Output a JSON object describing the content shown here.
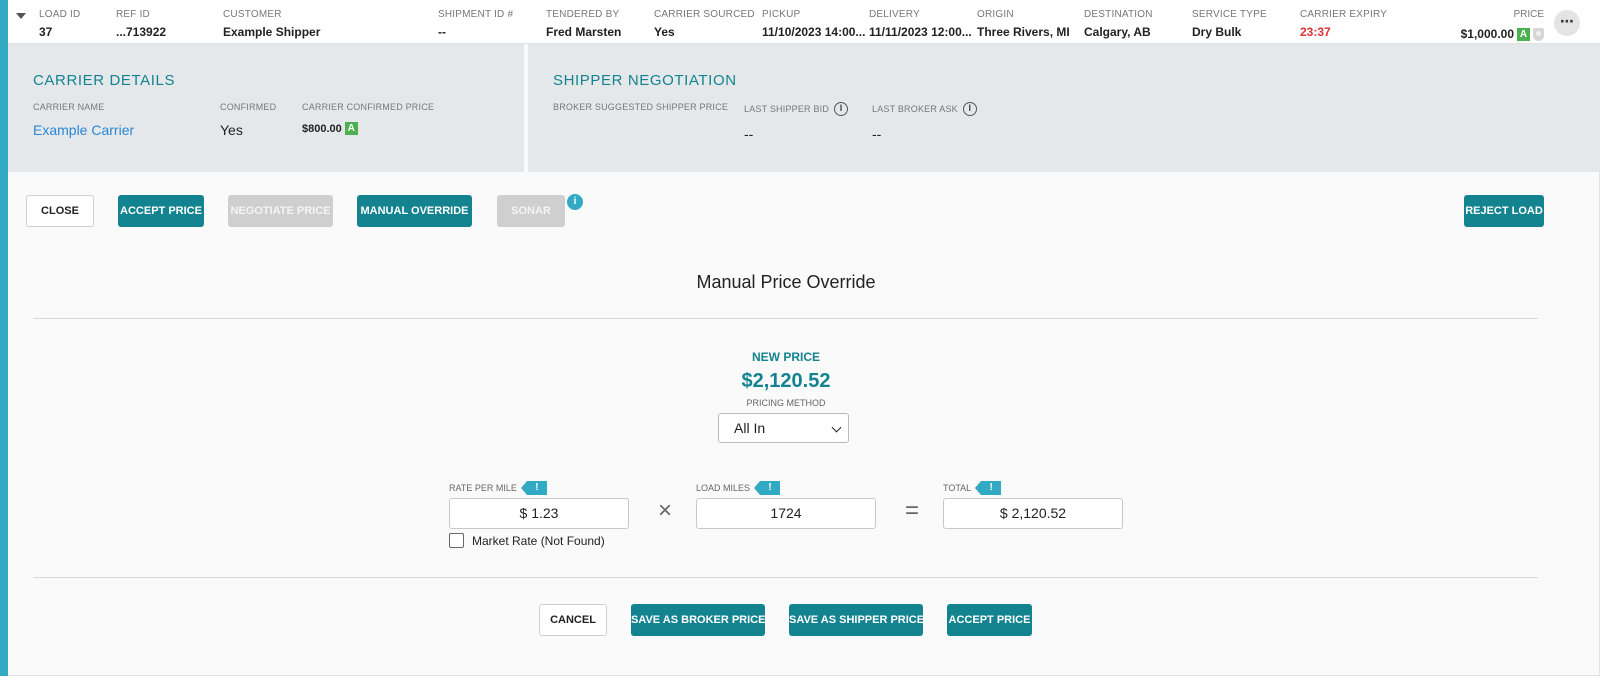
{
  "summary": {
    "columns": [
      {
        "label": "LOAD ID",
        "value": "37"
      },
      {
        "label": "REF ID",
        "value": "...713922"
      },
      {
        "label": "CUSTOMER",
        "value": "Example Shipper"
      },
      {
        "label": "SHIPMENT ID #",
        "value": "--"
      },
      {
        "label": "TENDERED BY",
        "value": "Fred Marsten"
      },
      {
        "label": "CARRIER SOURCED",
        "value": "Yes"
      },
      {
        "label": "PICKUP",
        "value": "11/10/2023 14:00..."
      },
      {
        "label": "DELIVERY",
        "value": "11/11/2023 12:00..."
      },
      {
        "label": "ORIGIN",
        "value": "Three Rivers, MI"
      },
      {
        "label": "DESTINATION",
        "value": "Calgary, AB"
      },
      {
        "label": "SERVICE TYPE",
        "value": "Dry Bulk"
      },
      {
        "label": "CARRIER EXPIRY",
        "value": "23:37"
      }
    ],
    "price_label": "PRICE",
    "price_value": "$1,000.00",
    "price_badge": "A",
    "more_label": "⋯"
  },
  "carrier_details": {
    "title": "CARRIER DETAILS",
    "carrier_name_label": "CARRIER NAME",
    "carrier_name": "Example Carrier",
    "confirmed_label": "CONFIRMED",
    "confirmed": "Yes",
    "confirmed_price_label": "CARRIER CONFIRMED PRICE",
    "confirmed_price": "$800.00",
    "confirmed_price_badge": "A"
  },
  "shipper_negotiation": {
    "title": "SHIPPER NEGOTIATION",
    "suggested_label": "BROKER SUGGESTED SHIPPER PRICE",
    "suggested_value": "",
    "last_bid_label": "LAST SHIPPER BID",
    "last_bid_value": "--",
    "last_ask_label": "LAST BROKER ASK",
    "last_ask_value": "--",
    "info_glyph": "i"
  },
  "toolbar": {
    "close": "CLOSE",
    "accept_price": "ACCEPT PRICE",
    "negotiate_price": "NEGOTIATE PRICE",
    "manual_override": "MANUAL OVERRIDE",
    "sonar": "SONAR",
    "sonar_info": "i",
    "reject_load": "REJECT LOAD"
  },
  "override": {
    "title": "Manual Price Override",
    "new_price_label": "NEW PRICE",
    "new_price": "$2,120.52",
    "pricing_method_label": "PRICING METHOD",
    "pricing_method": "All In",
    "rate_per_mile_label": "RATE PER MILE",
    "rate_per_mile": "$ 1.23",
    "load_miles_label": "LOAD MILES",
    "load_miles": "1724",
    "total_label": "TOTAL",
    "total": "$ 2,120.52",
    "flag_glyph": "!",
    "times_glyph": "×",
    "equals_glyph": "=",
    "market_rate_label": "Market Rate (Not Found)"
  },
  "footer": {
    "cancel": "CANCEL",
    "save_broker": "SAVE AS BROKER PRICE",
    "save_shipper": "SAVE AS SHIPPER PRICE",
    "accept_price": "ACCEPT PRICE"
  },
  "colors": {
    "accent": "#32aac4",
    "primary": "#138390",
    "expiry": "#e03131",
    "badge": "#4caf50"
  }
}
